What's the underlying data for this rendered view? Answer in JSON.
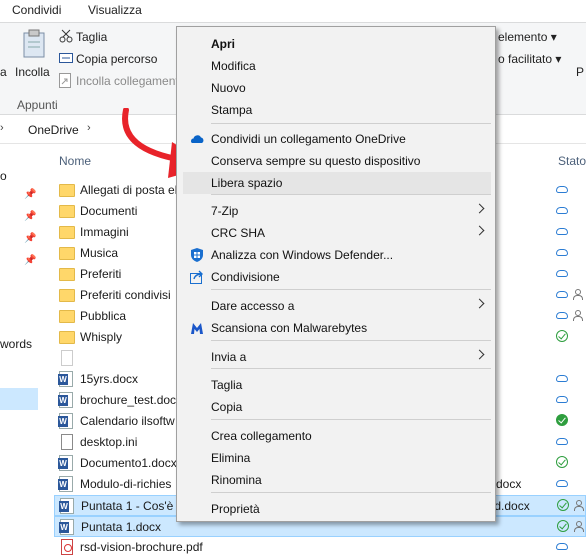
{
  "ribbon_tabs": [
    "Condividi",
    "Visualizza"
  ],
  "ribbon": {
    "paste_label": "Incolla",
    "partial_left": "a",
    "cut_label": "Taglia",
    "copy_path_label": "Copia percorso",
    "paste_shortcut_label": "Incolla collegamento",
    "group_label": "Appunti",
    "right_item_1": "elemento",
    "right_item_2": "o facilitato",
    "right_partial": "P"
  },
  "address": {
    "location": "OneDrive"
  },
  "nav": {
    "partial_1": "o",
    "partial_2": "words"
  },
  "columns": {
    "name": "Nome",
    "status": "Stato"
  },
  "files": [
    {
      "name": "Allegati di posta el",
      "type": "folder",
      "status": "cloud"
    },
    {
      "name": "Documenti",
      "type": "folder",
      "status": "cloud"
    },
    {
      "name": "Immagini",
      "type": "folder",
      "status": "cloud"
    },
    {
      "name": "Musica",
      "type": "folder",
      "status": "cloud"
    },
    {
      "name": "Preferiti",
      "type": "folder",
      "status": "cloud"
    },
    {
      "name": "Preferiti condivisi",
      "type": "folder",
      "status": "cloud-shared"
    },
    {
      "name": "Pubblica",
      "type": "folder",
      "status": "cloud-shared"
    },
    {
      "name": "Whisply",
      "type": "folder",
      "status": "check"
    },
    {
      "name": "",
      "type": "blank",
      "status": ""
    },
    {
      "name": "15yrs.docx",
      "type": "word",
      "status": "cloud"
    },
    {
      "name": "brochure_test.docx",
      "type": "word",
      "status": "cloud"
    },
    {
      "name": "Calendario ilsoftw",
      "type": "word",
      "status": "check-fill"
    },
    {
      "name": "desktop.ini",
      "type": "doc",
      "status": "cloud"
    },
    {
      "name": "Documento1.docx",
      "type": "word",
      "status": "check"
    },
    {
      "name": "Modulo-di-richies",
      "type": "word",
      "status": "cloud",
      "tail": "docx"
    },
    {
      "name": "Puntata 1 - Cos'è A",
      "type": "word",
      "status": "check-shared",
      "tail": "oud.docx",
      "selected": true
    },
    {
      "name": "Puntata 1.docx",
      "type": "word",
      "status": "check-shared",
      "selected": true
    },
    {
      "name": "rsd-vision-brochure.pdf",
      "type": "pdf",
      "status": "cloud"
    }
  ],
  "context_menu": {
    "items": [
      {
        "label": "Apri",
        "bold": true
      },
      {
        "label": "Modifica"
      },
      {
        "label": "Nuovo"
      },
      {
        "label": "Stampa"
      },
      {
        "label": "Condividi un collegamento OneDrive",
        "icon": "onedrive-cloud-icon"
      },
      {
        "label": "Conserva sempre su questo dispositivo"
      },
      {
        "label": "Libera spazio",
        "highlighted": true
      },
      {
        "label": "7-Zip",
        "submenu": true
      },
      {
        "label": "CRC SHA",
        "submenu": true
      },
      {
        "label": "Analizza con Windows Defender...",
        "icon": "windows-defender-icon"
      },
      {
        "label": "Condivisione",
        "icon": "share-icon"
      },
      {
        "label": "Dare accesso a",
        "submenu": true
      },
      {
        "label": "Scansiona con Malwarebytes",
        "icon": "malwarebytes-icon"
      },
      {
        "label": "Invia a",
        "submenu": true
      },
      {
        "label": "Taglia"
      },
      {
        "label": "Copia"
      },
      {
        "label": "Crea collegamento"
      },
      {
        "label": "Elimina"
      },
      {
        "label": "Rinomina"
      },
      {
        "label": "Proprietà"
      }
    ]
  },
  "colors": {
    "accent": "#0078d7",
    "selection": "#cce8ff",
    "arrow": "#e8232a",
    "onedrive": "#2b7cd3",
    "synced": "#2e9e3e"
  }
}
